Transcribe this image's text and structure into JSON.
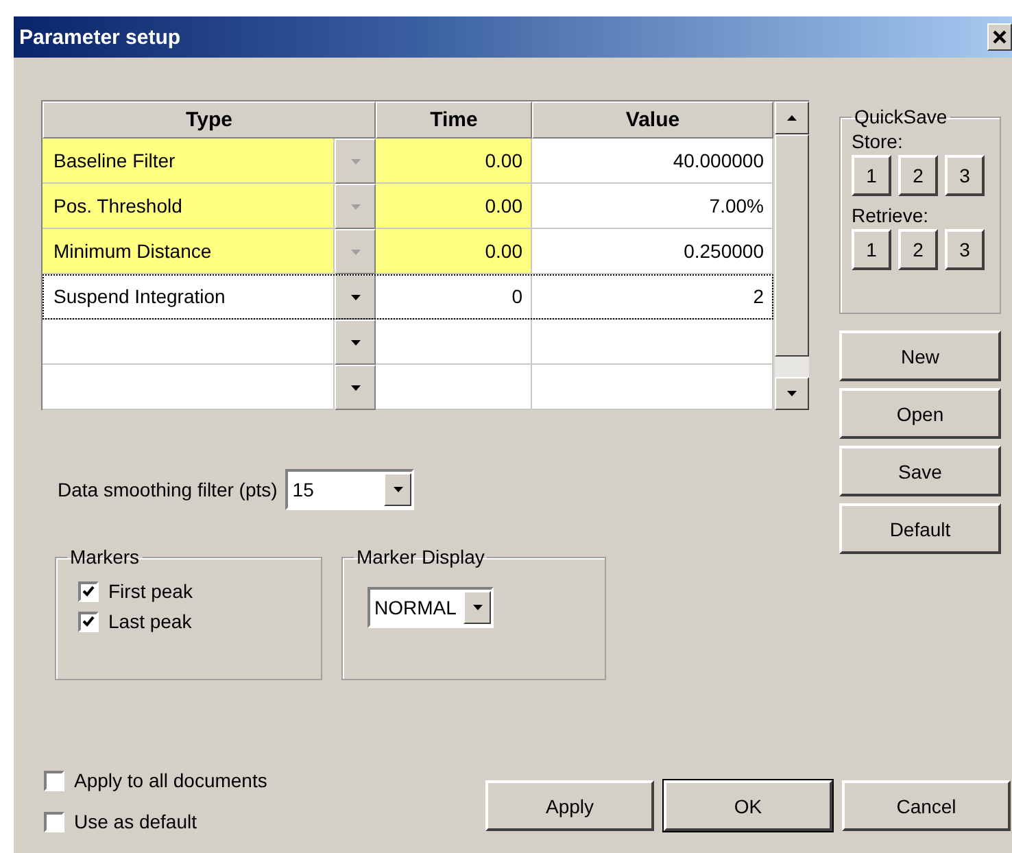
{
  "window": {
    "title": "Parameter setup"
  },
  "grid": {
    "columns": [
      "Type",
      "Time",
      "Value"
    ],
    "rows": [
      {
        "type": "Baseline Filter",
        "time": "0.00",
        "value": "40.000000",
        "locked": true,
        "focused": false
      },
      {
        "type": "Pos. Threshold",
        "time": "0.00",
        "value": "7.00%",
        "locked": true,
        "focused": false
      },
      {
        "type": "Minimum Distance",
        "time": "0.00",
        "value": "0.250000",
        "locked": true,
        "focused": false
      },
      {
        "type": "Suspend Integration",
        "time": "0",
        "value": "2",
        "locked": false,
        "focused": true
      },
      {
        "locked": false,
        "focused": false
      },
      {
        "locked": false,
        "focused": false
      }
    ]
  },
  "quicksave": {
    "title": "QuickSave",
    "store_label": "Store:",
    "store_buttons": [
      "1",
      "2",
      "3"
    ],
    "retrieve_label": "Retrieve:",
    "retrieve_buttons": [
      "1",
      "2",
      "3"
    ]
  },
  "file_buttons": [
    "New",
    "Open",
    "Save",
    "Default"
  ],
  "smoothing": {
    "label": "Data smoothing filter (pts)",
    "value": "15"
  },
  "markers": {
    "title": "Markers",
    "items": [
      {
        "label": "First peak",
        "checked": true
      },
      {
        "label": "Last peak",
        "checked": true
      }
    ]
  },
  "marker_display": {
    "title": "Marker Display",
    "value": "NORMAL"
  },
  "options": [
    {
      "label": "Apply to all documents",
      "checked": false
    },
    {
      "label": "Use as default",
      "checked": false
    }
  ],
  "buttons": [
    {
      "label": "Apply",
      "default": false
    },
    {
      "label": "OK",
      "default": true
    },
    {
      "label": "Cancel",
      "default": false
    }
  ]
}
